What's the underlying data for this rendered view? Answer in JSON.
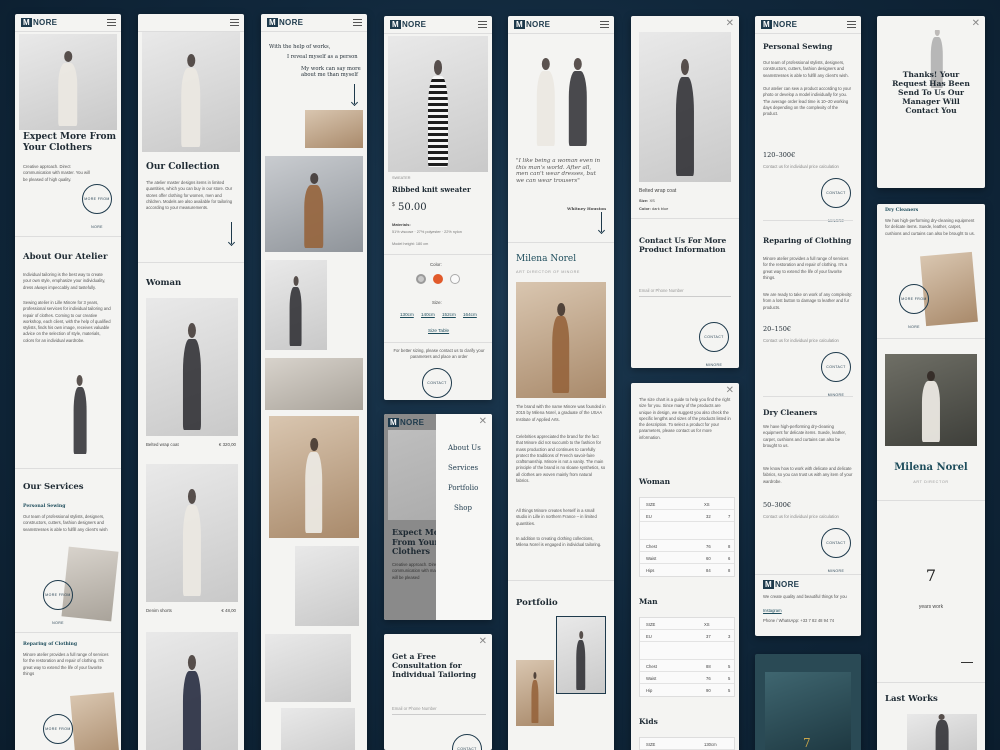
{
  "brand": {
    "logo_mark": "M",
    "logo_text": "NORE"
  },
  "col1": {
    "hero_title": "Expect More From Your Clothers",
    "hero_text": "Creative approach. Direct communication with master. You will be pleased of high quality.",
    "stamp_text": "MORE FROM NORE",
    "about_title": "About Our Atelier",
    "about_text_1": "Individual tailoring is the best way to create your own style, emphasize your individuality, dress always impeccably and tastefully.",
    "about_text_2": "Sewing atelier in Lille Minore for 3 years, professional services for individual tailoring and repair of clothes. Coming to our creative workshop, each client, with the help of qualified stylists, finds his own image, receives valuable advice on the selection of style, materials, colors for an individual wardrobe.",
    "services_title": "Our Services",
    "services_sub": "Personal Sewing",
    "services_text": "Our team of professional stylists, designers, constructors, cutters, fashion designers and seamstresses is able to fulfill any client's wish",
    "repair_title": "Reparing of Clothing",
    "repair_text": "Minore atelier provides a full range of services for the restoration and repair of clothing. It's great way to extend the life of your favorite things"
  },
  "col2": {
    "collection_title": "Our Collection",
    "collection_text": "The atelier master designs items in limited quantities, which you can buy in our store. Our stores offer clothing for women, men and children. Models are also available for tailoring according to your measurements.",
    "woman_title": "Woman",
    "product1_name": "Belted wrap coat",
    "product1_price": "€ 320,00",
    "product2_name": "Denim shorts",
    "product2_price": "€ 48,00"
  },
  "col3": {
    "quote_1": "With the help of works,",
    "quote_2": "I reveal myself as a person",
    "quote_3": "My work can say more about me than myself"
  },
  "col4": {
    "category": "SWEATER",
    "product_name": "Ribbed knit sweater",
    "currency": "$",
    "price": "50.00",
    "materials_label": "Materials:",
    "materials_value": "51% viscose · 27% polyester · 22% nylon",
    "height_label": "Model height: 180 cm",
    "color_label": "Color:",
    "size_label": "Size:",
    "sizes": [
      "130cm",
      "140cm",
      "152cm",
      "164cm"
    ],
    "size_table_link": "Size Table",
    "fit_text": "For better sizing, please contact us to clarify your parameters and place an order",
    "stamp_text": "CONTACT MINORE",
    "nav_items": [
      "About Us",
      "Services",
      "Portfolio",
      "Shop"
    ],
    "menu_hero_title": "Expect More From Your Clothers",
    "menu_hero_text": "Creative approach. Direct communication with master. You will be pleased",
    "consult_title": "Get a Free Consultation for Individual Tailoring",
    "consult_placeholder": "Email or Phone Number"
  },
  "col5": {
    "quote": "\"I like being a woman even in this man's world. After all, men can't wear dresses, but we can wear trousers\"",
    "quote_author": "Whitney Houston",
    "designer_name": "Milena Norel",
    "designer_role": "ART DIRECTOR OF MINORE",
    "bio_1": "The brand with the name Minore was founded in 2015 by Milena Norel, a graduate of the USAA Institute of Applied Arts.",
    "bio_2": "Celebrities appreciated the brand for the fact that Minore did not succumb to the fashion for mass production and continues to carefully protect the traditions of French savoir-faire craftsmanship. Minore is not a vanity. The main principle of the brand is no sloane synthetics, so all clothes are woven mainly from natural fabrics.",
    "bio_3": "All things Minore creates herself in a small studio in Lille in northern France – in limited quantities.",
    "bio_4": "In addition to creating clothing collections, Milena Norel is engaged in individual tailoring.",
    "portfolio_title": "Portfolio"
  },
  "col6": {
    "product_name": "Belted wrap coat",
    "size_label": "Size:",
    "size_value": "XS",
    "color_label": "Color:",
    "color_value": "dark blue",
    "contact_title": "Contact Us For More Product Information",
    "contact_placeholder": "Email or Phone Number",
    "stamp_text": "CONTACT MINORE",
    "size_intro": "The size chart is a guide to help you find the right size for you. Since many of the products are unique in design, we suggest you also check the specific lengths and sizes of the products listed in the description. To select a product for your parameters, please contact us for more information.",
    "woman_title": "Woman",
    "woman_table": {
      "header": [
        "SIZE",
        "XS"
      ],
      "rows": [
        [
          "EU",
          "32",
          "7"
        ],
        [
          "Chest",
          "76",
          "8"
        ],
        [
          "Waist",
          "60",
          "6"
        ],
        [
          "Hips",
          "84",
          "8"
        ]
      ]
    },
    "man_title": "Man",
    "man_table": {
      "header": [
        "SIZE",
        "XS"
      ],
      "rows": [
        [
          "EU",
          "37",
          "3"
        ],
        [
          "Chest",
          "88",
          "5"
        ],
        [
          "Waist",
          "76",
          "5"
        ],
        [
          "Hip",
          "90",
          "5"
        ]
      ]
    },
    "kids_title": "Kids",
    "kids_header": [
      "SIZE",
      "130cm"
    ]
  },
  "col7": {
    "sewing_title": "Personal Sewing",
    "sewing_text_1": "Our team of professional stylists, designers, constructors, cutters, fashion designers and seamstresses is able to fulfill any client's wish.",
    "sewing_text_2": "Our atelier can sew a product according to your photo or develop a model individually for you. The average order lead time is 10–20 working days depending on the complexity of the product.",
    "sewing_price": "120–300€",
    "sewing_link": "Contact us for individual price calculation",
    "repair_title": "Reparing of Clothing",
    "repair_text_1": "Minore atelier provides a full range of services for the restoration and repair of clothing. It's a great way to extend the life of your favorite things.",
    "repair_text_2": "We are ready to take on work of any complexity: from a lost button to damage to leather and fur products.",
    "repair_price": "20–150€",
    "repair_link": "Contact us for individual price calculation",
    "dry_title": "Dry Cleaners",
    "dry_text_1": "We have high-performing dry-cleaning equipment for delicate items. Suede, leather, carpet, cushions and curtains can also be brought to us.",
    "dry_text_2": "We know how to work with delicate and delicate fabrics, so you can trust us with any item of your wardrobe.",
    "dry_price": "50–300€",
    "dry_link": "Contact us for individual price calculation",
    "stamp_text": "CONTACT MINORE",
    "footer_text": "We create quality and beautiful things for you",
    "instagram": "Instagram",
    "phone": "Phone / WhatsApp: +33 7 82 48 94 74"
  },
  "col8": {
    "thanks_text": "Thanks! Your Request Has Been Send To Us Our Manager Will Contact You",
    "dry_title": "Dry Cleaners",
    "dry_text": "We has high-performing dry-cleaning equipment for delicate items. Suede, leather, carpet, cushions and curtains can also be brought to us.",
    "stamp_text": "MORE FROM NORE",
    "designer_name": "Milena Norel",
    "designer_role": "ART DIRECTOR",
    "years_number": "7",
    "years_label": "years work",
    "last_works_title": "Last Works"
  }
}
